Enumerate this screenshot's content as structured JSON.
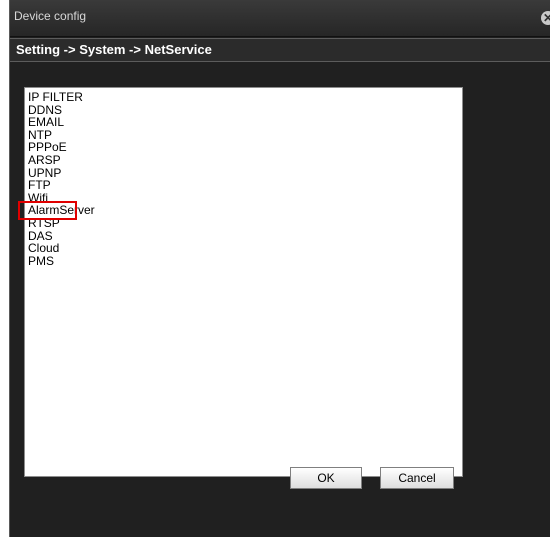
{
  "window": {
    "title": "Device config",
    "close_glyph": "✕",
    "close_icon": "close-icon"
  },
  "breadcrumb": {
    "text": "Setting -> System -> NetService"
  },
  "services": {
    "items": [
      "IP FILTER",
      "DDNS",
      "EMAIL",
      "NTP",
      "PPPoE",
      "ARSP",
      "UPNP",
      "FTP",
      "Wifi",
      "AlarmServer",
      "RTSP",
      "DAS",
      "Cloud",
      "PMS"
    ],
    "highlighted": "Wifi",
    "highlight_color": "#e00000"
  },
  "buttons": {
    "ok": "OK",
    "cancel": "Cancel"
  }
}
